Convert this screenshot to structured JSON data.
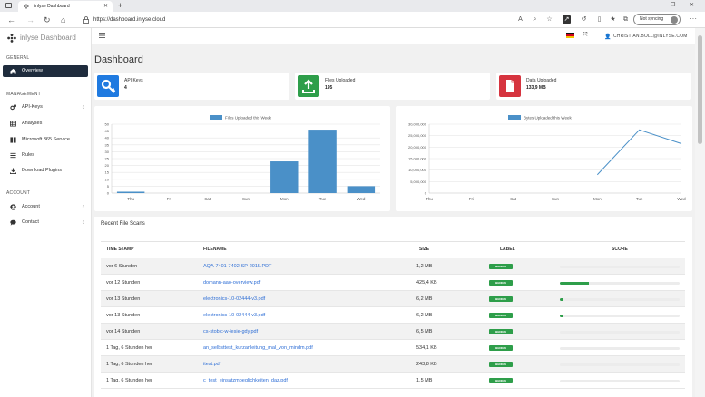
{
  "browser": {
    "tab_title": "inlyse Dashboard",
    "url": "https://dashboard.inlyse.cloud",
    "sync_label": "Not syncing"
  },
  "brand": {
    "name": "inlyse Dashboard"
  },
  "sidebar": {
    "general_label": "GENERAL",
    "management_label": "MANAGEMENT",
    "account_label": "ACCOUNT",
    "items": [
      {
        "label": "Overview"
      },
      {
        "label": "API-Keys"
      },
      {
        "label": "Analyses"
      },
      {
        "label": "Microsoft 365 Service"
      },
      {
        "label": "Rules"
      },
      {
        "label": "Download Plugins"
      },
      {
        "label": "Account"
      },
      {
        "label": "Contact"
      }
    ]
  },
  "header": {
    "user": "CHRISTIAN.BOLL@INLYSE.COM"
  },
  "page": {
    "title": "Dashboard"
  },
  "stats": [
    {
      "label": "API Keys",
      "value": "4",
      "color": "#1f7ae0",
      "icon": "key-icon"
    },
    {
      "label": "Files Uploaded",
      "value": "195",
      "color": "#2e9e4a",
      "icon": "upload-icon"
    },
    {
      "label": "Data Uploaded",
      "value": "133,9 MB",
      "color": "#d6343f",
      "icon": "file-icon"
    }
  ],
  "chart_data": [
    {
      "type": "bar",
      "title": "",
      "categories": [
        "Thu",
        "Fri",
        "Sat",
        "Sun",
        "Mon",
        "Tue",
        "Wed"
      ],
      "series": [
        {
          "name": "Files Uploaded this Week",
          "values": [
            1,
            0,
            0,
            0,
            23,
            46,
            5
          ]
        }
      ],
      "ylim": [
        0,
        50
      ],
      "yticks": [
        "0",
        "5",
        "10",
        "15",
        "20",
        "25",
        "30",
        "35",
        "40",
        "45",
        "50"
      ],
      "color": "#4a90c8",
      "legend": "top-center",
      "grid": true
    },
    {
      "type": "line",
      "title": "",
      "categories": [
        "Thu",
        "Fri",
        "Sat",
        "Sun",
        "Mon",
        "Tue",
        "Wed"
      ],
      "series": [
        {
          "name": "Bytes Uploaded this Week",
          "values": [
            null,
            null,
            null,
            null,
            8000000,
            27500000,
            21500000
          ]
        }
      ],
      "ylim": [
        0,
        30000000
      ],
      "yticks": [
        "0",
        "5,000,000",
        "10,000,000",
        "15,000,000",
        "20,000,000",
        "25,000,000",
        "30,000,000"
      ],
      "color": "#4a90c8",
      "legend": "top-center",
      "grid": true
    }
  ],
  "table": {
    "title": "Recent File Scans",
    "columns": [
      "TIME STAMP",
      "FILENAME",
      "SIZE",
      "LABEL",
      "SCORE"
    ],
    "rows": [
      {
        "time": "vor 6 Stunden",
        "file": "AQA-7401-7402-SP-2015.PDF",
        "size": "1,2 MB",
        "label": "BENIGN",
        "score": 0
      },
      {
        "time": "vor 12 Stunden",
        "file": "domann-aao-overview.pdf",
        "size": "425,4 KB",
        "label": "BENIGN",
        "score": 0.24
      },
      {
        "time": "vor 13 Stunden",
        "file": "electronics-10-02444-v3.pdf",
        "size": "6,2 MB",
        "label": "BENIGN",
        "score": 0.02
      },
      {
        "time": "vor 13 Stunden",
        "file": "electronics-10-02444-v3.pdf",
        "size": "6,2 MB",
        "label": "BENIGN",
        "score": 0.02
      },
      {
        "time": "vor 14 Stunden",
        "file": "cs-stobic-w-lesie-gdy.pdf",
        "size": "6,5 MB",
        "label": "BENIGN",
        "score": 0
      },
      {
        "time": "1 Tag, 6 Stunden her",
        "file": "an_selbsttest_kurzanleitung_mal_von_mindm.pdf",
        "size": "534,1 KB",
        "label": "BENIGN",
        "score": 0
      },
      {
        "time": "1 Tag, 6 Stunden her",
        "file": "itest.pdf",
        "size": "243,8 KB",
        "label": "BENIGN",
        "score": 0
      },
      {
        "time": "1 Tag, 6 Stunden her",
        "file": "c_test_einsatzmoeglichkeiten_daz.pdf",
        "size": "1,5 MB",
        "label": "BENIGN",
        "score": 0
      }
    ]
  }
}
